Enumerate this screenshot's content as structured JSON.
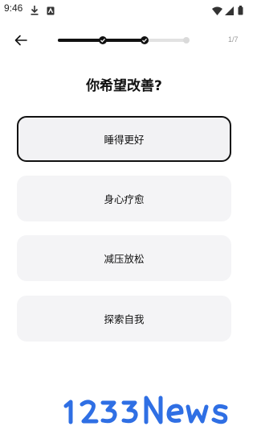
{
  "status_bar": {
    "time": "9:46",
    "icons": [
      "download-icon",
      "notification-box-icon",
      "wifi-icon",
      "signal-icon",
      "battery-icon"
    ]
  },
  "header": {
    "back_icon": "arrow-left-icon",
    "progress": {
      "completed_steps": 2,
      "total_dots": 3
    },
    "step_indicator": "1/7"
  },
  "question": {
    "title": "你希望改善?"
  },
  "options": [
    {
      "label": "睡得更好",
      "selected": true
    },
    {
      "label": "身心疗愈",
      "selected": false
    },
    {
      "label": "减压放松",
      "selected": false
    },
    {
      "label": "探索自我",
      "selected": false
    }
  ],
  "watermark": {
    "text": "1233News",
    "color": "#2f6fe4"
  },
  "colors": {
    "accent": "#111111",
    "option_bg": "#f4f4f6",
    "track": "#e2e2e2"
  }
}
